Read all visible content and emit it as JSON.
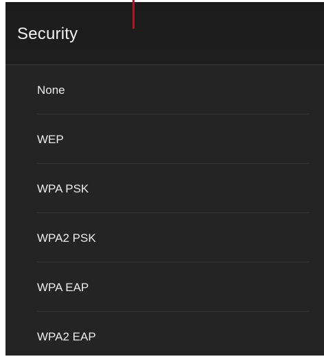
{
  "dialog": {
    "title": "Security",
    "options": [
      {
        "label": "None"
      },
      {
        "label": "WEP"
      },
      {
        "label": "WPA PSK"
      },
      {
        "label": "WPA2 PSK"
      },
      {
        "label": "WPA EAP"
      },
      {
        "label": "WPA2 EAP"
      }
    ]
  },
  "colors": {
    "header_background": "#1c1c1c",
    "list_background": "#242424",
    "divider": "#363636",
    "text": "#ededed",
    "callout_line": "#b4122b"
  }
}
